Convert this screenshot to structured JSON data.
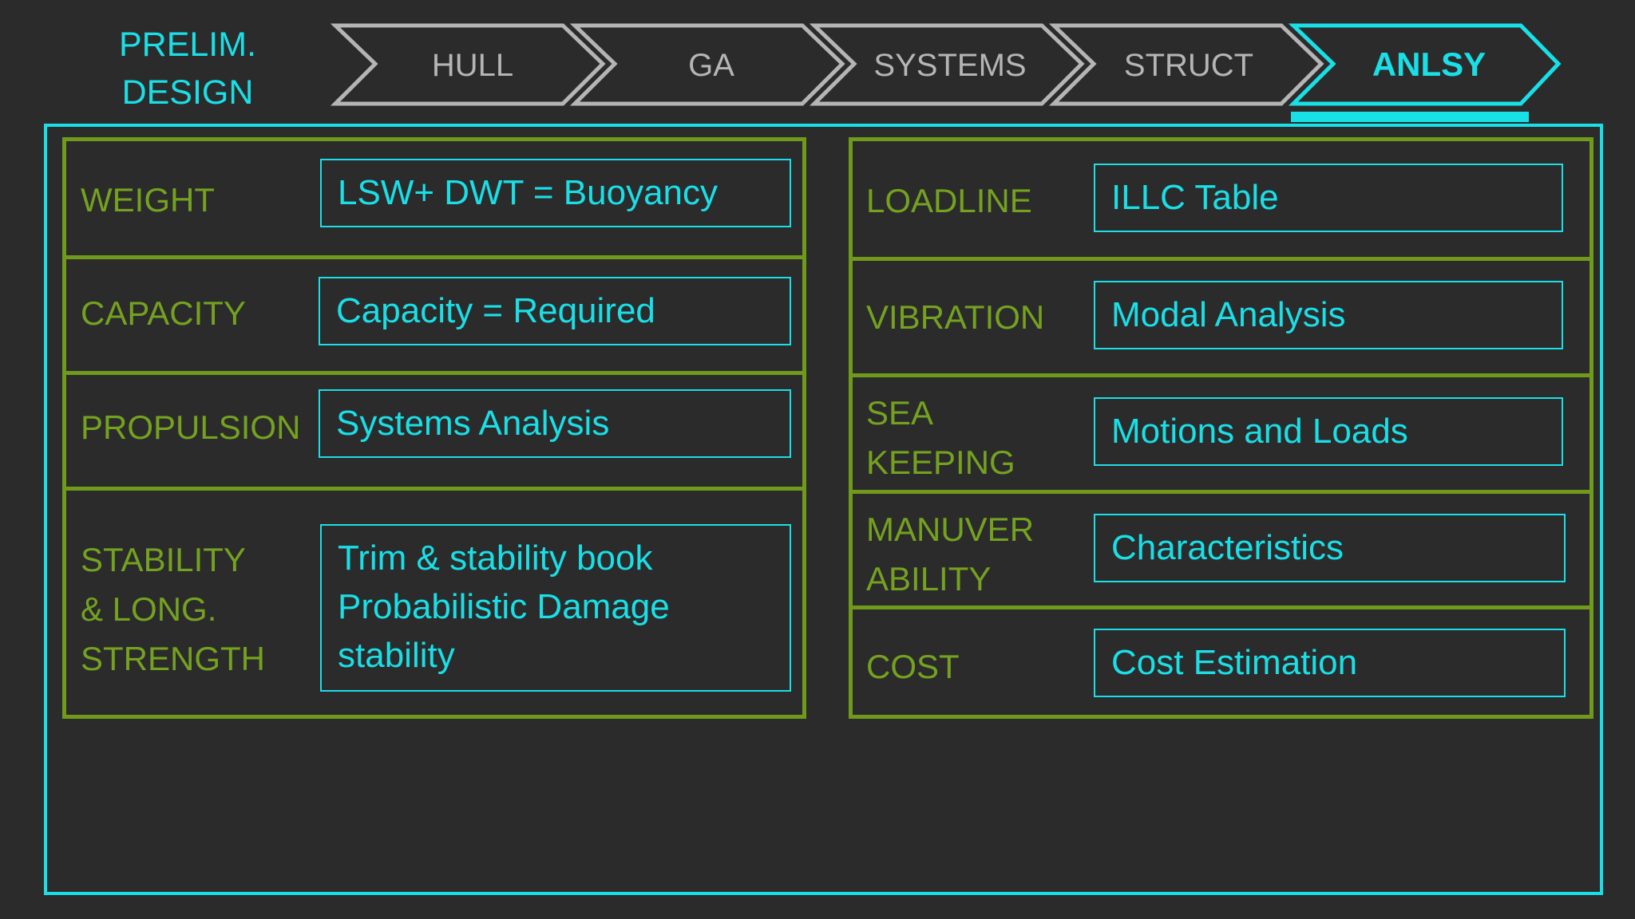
{
  "header": {
    "title_lines": [
      "PRELIM.",
      "DESIGN"
    ]
  },
  "steps": [
    {
      "label": "HULL",
      "active": false
    },
    {
      "label": "GA",
      "active": false
    },
    {
      "label": "SYSTEMS",
      "active": false
    },
    {
      "label": "STRUCT",
      "active": false
    },
    {
      "label": "ANLSY",
      "active": true
    }
  ],
  "left_panel": {
    "rows": [
      {
        "label": "WEIGHT",
        "value": "LSW+ DWT = Buoyancy"
      },
      {
        "label": "CAPACITY",
        "value": "Capacity = Required"
      },
      {
        "label": "PROPULSION",
        "value": "Systems Analysis"
      },
      {
        "label": "STABILITY\n & LONG.\nSTRENGTH",
        "value": "Trim & stability book\nProbabilistic Damage\nstability"
      }
    ]
  },
  "right_panel": {
    "rows": [
      {
        "label": "LOADLINE",
        "value": "ILLC Table"
      },
      {
        "label": "VIBRATION",
        "value": "Modal Analysis"
      },
      {
        "label": "SEA\nKEEPING",
        "value": "Motions and Loads"
      },
      {
        "label": "MANUVER\nABILITY",
        "value": "Characteristics"
      },
      {
        "label": "COST",
        "value": "Cost Estimation"
      }
    ]
  },
  "colors": {
    "background": "#2b2b2c",
    "accent_cyan": "#19dfe6",
    "panel_green": "#6f9a1b",
    "label_green": "#74a21f",
    "step_inactive": "#b5b5b5"
  }
}
